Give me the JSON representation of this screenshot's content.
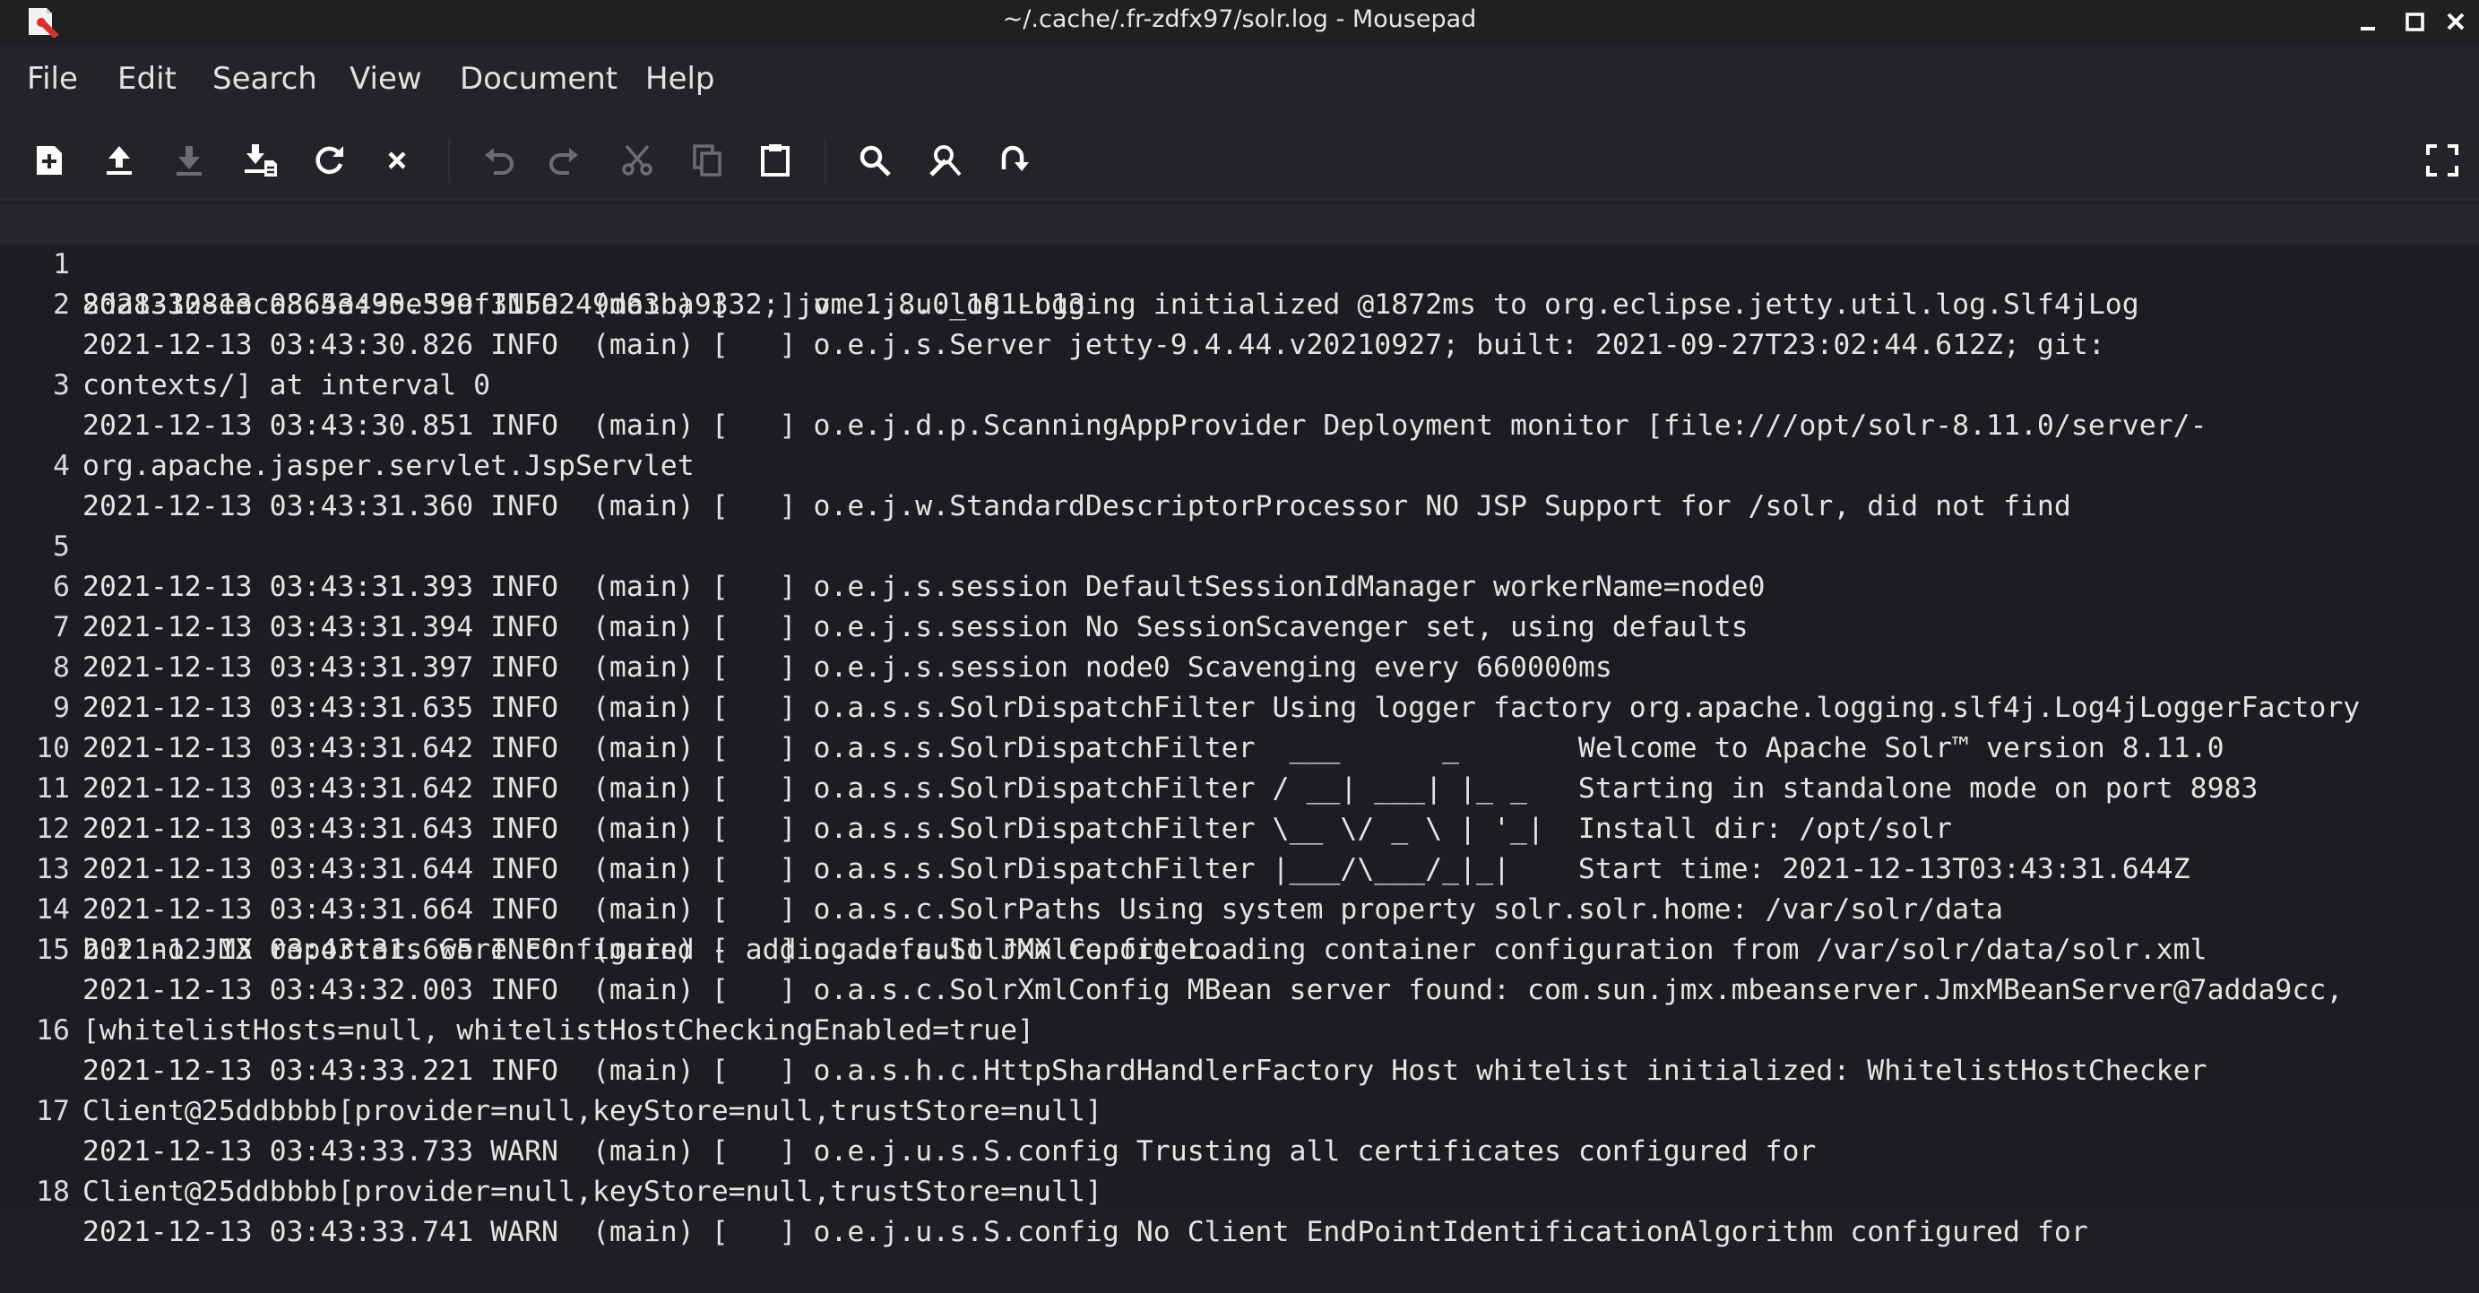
{
  "window": {
    "title": "~/.cache/.fr-zdfx97/solr.log - Mousepad",
    "controls": [
      "minimize-icon",
      "maximize-icon",
      "close-icon"
    ]
  },
  "menu": {
    "items": [
      "File",
      "Edit",
      "Search",
      "View",
      "Document",
      "Help"
    ]
  },
  "toolbar": {
    "buttons": [
      {
        "icon": "new-document-icon",
        "enabled": true
      },
      {
        "icon": "open-upload-icon",
        "enabled": true
      },
      {
        "icon": "save-download-icon",
        "enabled": false
      },
      {
        "icon": "save-as-icon",
        "enabled": true
      },
      {
        "icon": "reload-icon",
        "enabled": true
      },
      {
        "icon": "close-icon",
        "enabled": true
      },
      {
        "icon": "undo-icon",
        "enabled": false
      },
      {
        "icon": "redo-icon",
        "enabled": false
      },
      {
        "icon": "cut-icon",
        "enabled": false
      },
      {
        "icon": "copy-icon",
        "enabled": false
      },
      {
        "icon": "paste-icon",
        "enabled": true
      },
      {
        "icon": "find-icon",
        "enabled": true
      },
      {
        "icon": "find-replace-icon",
        "enabled": true
      },
      {
        "icon": "go-to-line-icon",
        "enabled": true
      },
      {
        "icon": "fullscreen-icon",
        "enabled": true
      }
    ]
  },
  "editor": {
    "lines": [
      {
        "n": "1",
        "text": "2021-12-13 03:43:30.399 INFO  (main) [   ] o.e.j.u.log Logging initialized @1872ms to org.eclipse.jetty.util.log.Slf4jLog",
        "cont": ""
      },
      {
        "n": "2",
        "text": "2021-12-13 03:43:30.826 INFO  (main) [   ] o.e.j.s.Server jetty-9.4.44.v20210927; built: 2021-09-27T23:02:44.612Z; git:",
        "cont": "8da83308eeca865e495e53ef315a249d63ba9332; jvm 1.8.0_181-b13"
      },
      {
        "n": "3",
        "text": "2021-12-13 03:43:30.851 INFO  (main) [   ] o.e.j.d.p.ScanningAppProvider Deployment monitor [file:///opt/solr-8.11.0/server/-",
        "cont": "contexts/] at interval 0"
      },
      {
        "n": "4",
        "text": "2021-12-13 03:43:31.360 INFO  (main) [   ] o.e.j.w.StandardDescriptorProcessor NO JSP Support for /solr, did not find",
        "cont": "org.apache.jasper.servlet.JspServlet"
      },
      {
        "n": "5",
        "text": "2021-12-13 03:43:31.393 INFO  (main) [   ] o.e.j.s.session DefaultSessionIdManager workerName=node0",
        "cont": ""
      },
      {
        "n": "6",
        "text": "2021-12-13 03:43:31.394 INFO  (main) [   ] o.e.j.s.session No SessionScavenger set, using defaults",
        "cont": ""
      },
      {
        "n": "7",
        "text": "2021-12-13 03:43:31.397 INFO  (main) [   ] o.e.j.s.session node0 Scavenging every 660000ms",
        "cont": ""
      },
      {
        "n": "8",
        "text": "2021-12-13 03:43:31.635 INFO  (main) [   ] o.a.s.s.SolrDispatchFilter Using logger factory org.apache.logging.slf4j.Log4jLoggerFactory",
        "cont": ""
      },
      {
        "n": "9",
        "text": "2021-12-13 03:43:31.642 INFO  (main) [   ] o.a.s.s.SolrDispatchFilter  ___      _       Welcome to Apache Solr™ version 8.11.0",
        "cont": ""
      },
      {
        "n": "10",
        "text": "2021-12-13 03:43:31.642 INFO  (main) [   ] o.a.s.s.SolrDispatchFilter / __| ___| |_ _   Starting in standalone mode on port 8983",
        "cont": ""
      },
      {
        "n": "11",
        "text": "2021-12-13 03:43:31.643 INFO  (main) [   ] o.a.s.s.SolrDispatchFilter \\__ \\/ _ \\ | '_|  Install dir: /opt/solr",
        "cont": ""
      },
      {
        "n": "12",
        "text": "2021-12-13 03:43:31.644 INFO  (main) [   ] o.a.s.s.SolrDispatchFilter |___/\\___/_|_|    Start time: 2021-12-13T03:43:31.644Z",
        "cont": ""
      },
      {
        "n": "13",
        "text": "2021-12-13 03:43:31.664 INFO  (main) [   ] o.a.s.c.SolrPaths Using system property solr.solr.home: /var/solr/data",
        "cont": ""
      },
      {
        "n": "14",
        "text": "2021-12-13 03:43:31.665 INFO  (main) [   ] o.a.s.c.SolrXmlConfig Loading container configuration from /var/solr/data/solr.xml",
        "cont": ""
      },
      {
        "n": "15",
        "text": "2021-12-13 03:43:32.003 INFO  (main) [   ] o.a.s.c.SolrXmlConfig MBean server found: com.sun.jmx.mbeanserver.JmxMBeanServer@7adda9cc,",
        "cont": "but no JMX reporters were configured - adding default JMX reporter."
      },
      {
        "n": "16",
        "text": "2021-12-13 03:43:33.221 INFO  (main) [   ] o.a.s.h.c.HttpShardHandlerFactory Host whitelist initialized: WhitelistHostChecker",
        "cont": "[whitelistHosts=null, whitelistHostCheckingEnabled=true]"
      },
      {
        "n": "17",
        "text": "2021-12-13 03:43:33.733 WARN  (main) [   ] o.e.j.u.s.S.config Trusting all certificates configured for",
        "cont": "Client@25ddbbbb[provider=null,keyStore=null,trustStore=null]"
      },
      {
        "n": "18",
        "text": "2021-12-13 03:43:33.741 WARN  (main) [   ] o.e.j.u.s.S.config No Client EndPointIdentificationAlgorithm configured for",
        "cont": "Client@25ddbbbb[provider=null,keyStore=null,trustStore=null]"
      }
    ]
  },
  "colors": {
    "background": "#1c1d20",
    "chrome": "#232427",
    "text": "#e4e4e4",
    "app_icon_accent": "#d9322f"
  }
}
